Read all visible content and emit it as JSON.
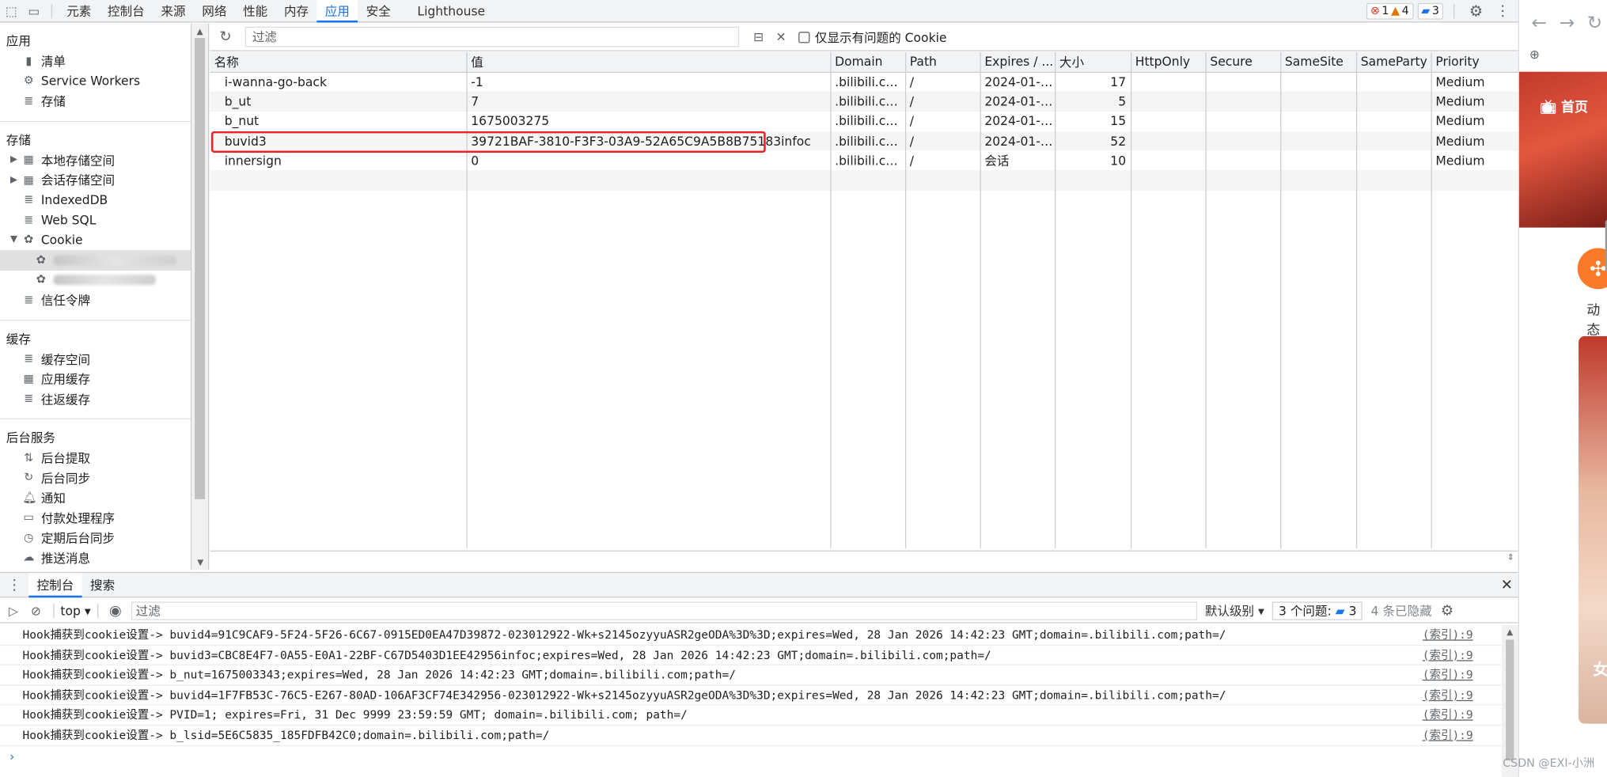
{
  "toolbar": {
    "tabs": [
      "元素",
      "控制台",
      "来源",
      "网络",
      "性能",
      "内存",
      "应用",
      "安全",
      "Lighthouse"
    ],
    "active_tab": "应用",
    "errors": "1",
    "warnings": "4",
    "messages": "3"
  },
  "sidebar": {
    "sec_app": "应用",
    "app_items": [
      "清单",
      "Service Workers",
      "存储"
    ],
    "sec_storage": "存储",
    "storage_items": [
      "本地存储空间",
      "会话存储空间",
      "IndexedDB",
      "Web SQL",
      "Cookie",
      "信任令牌"
    ],
    "sec_cache": "缓存",
    "cache_items": [
      "缓存空间",
      "应用缓存",
      "往返缓存"
    ],
    "sec_bg": "后台服务",
    "bg_items": [
      "后台提取",
      "后台同步",
      "通知",
      "付款处理程序",
      "定期后台同步",
      "推送消息"
    ]
  },
  "filter": {
    "placeholder": "过滤",
    "only_issues_label": "仅显示有问题的 Cookie"
  },
  "cookie_table": {
    "columns": [
      "名称",
      "值",
      "Domain",
      "Path",
      "Expires / ...",
      "大小",
      "HttpOnly",
      "Secure",
      "SameSite",
      "SameParty",
      "Priority"
    ],
    "rows": [
      {
        "name": "i-wanna-go-back",
        "value": "-1",
        "domain": ".bilibili.com",
        "path": "/",
        "expires": "2024-01-2...",
        "size": "17",
        "priority": "Medium"
      },
      {
        "name": "b_ut",
        "value": "7",
        "domain": ".bilibili.com",
        "path": "/",
        "expires": "2024-01-2...",
        "size": "5",
        "priority": "Medium"
      },
      {
        "name": "b_nut",
        "value": "1675003275",
        "domain": ".bilibili.com",
        "path": "/",
        "expires": "2024-01-2...",
        "size": "15",
        "priority": "Medium"
      },
      {
        "name": "buvid3",
        "value": "39721BAF-3810-F3F3-03A9-52A65C9A5B8B75183infoc",
        "domain": ".bilibili.com",
        "path": "/",
        "expires": "2024-01-2...",
        "size": "52",
        "priority": "Medium"
      },
      {
        "name": "innersign",
        "value": "0",
        "domain": ".bilibili.com",
        "path": "/",
        "expires": "会话",
        "size": "10",
        "priority": "Medium"
      }
    ]
  },
  "drawer": {
    "tabs": [
      "控制台",
      "搜索"
    ],
    "context": "top",
    "filter_placeholder": "过滤",
    "level": "默认级别",
    "issues_label": "3 个问题:",
    "issues_count": "3",
    "hidden": "4 条已隐藏"
  },
  "console_logs": [
    {
      "msg": "Hook捕获到cookie设置-> buvid4=91C9CAF9-5F24-5F26-6C67-0915ED0EA47D39872-023012922-Wk+s2145ozyyuASR2geODA%3D%3D;expires=Wed, 28 Jan 2026 14:42:23 GMT;domain=.bilibili.com;path=/",
      "src": "(索引):9"
    },
    {
      "msg": "Hook捕获到cookie设置-> buvid3=CBC8E4F7-0A55-E0A1-22BF-C67D5403D1EE42956infoc;expires=Wed, 28 Jan 2026 14:42:23 GMT;domain=.bilibili.com;path=/",
      "src": "(索引):9"
    },
    {
      "msg": "Hook捕获到cookie设置-> b_nut=1675003343;expires=Wed, 28 Jan 2026 14:42:23 GMT;domain=.bilibili.com;path=/",
      "src": "(索引):9"
    },
    {
      "msg": "Hook捕获到cookie设置-> buvid4=1F7FB53C-76C5-E267-80AD-106AF3CF74E342956-023012922-Wk+s2145ozyyuASR2geODA%3D%3D;expires=Wed, 28 Jan 2026 14:42:23 GMT;domain=.bilibili.com;path=/",
      "src": "(索引):9"
    },
    {
      "msg": "Hook捕获到cookie设置-> PVID=1; expires=Fri, 31 Dec 9999 23:59:59 GMT; domain=.bilibili.com; path=/",
      "src": "(索引):9"
    },
    {
      "msg": "Hook捕获到cookie设置-> b_lsid=5E6C5835_185FDFB42C0;domain=.bilibili.com;path=/",
      "src": "(索引):9"
    }
  ],
  "browser": {
    "home_label": "首页",
    "dynamic_label": "动态",
    "card_text": "女"
  },
  "watermark": "CSDN @EXI-小洲",
  "colors": {
    "accent": "#1a73e8",
    "highlight_border": "#e8252a",
    "error": "#d93025",
    "warning": "#e37400"
  }
}
